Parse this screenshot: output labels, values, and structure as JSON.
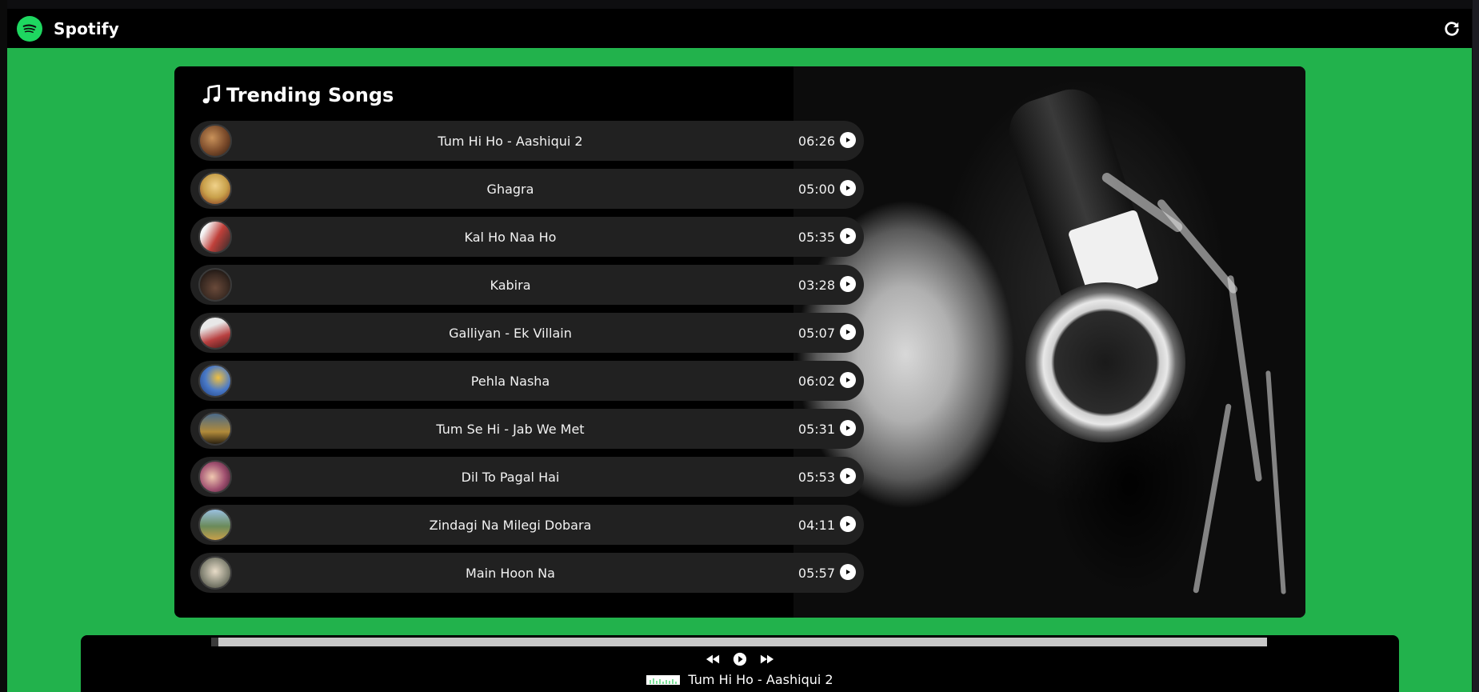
{
  "navbar": {
    "brand": "Spotify",
    "logo_icon": "spotify-logo-icon",
    "refresh_icon": "refresh-icon"
  },
  "colors": {
    "accent_green": "#22b24c",
    "logo_green": "#1ed760",
    "row_bg": "#212121",
    "card_bg": "#000000"
  },
  "main": {
    "title": "Trending Songs",
    "title_icon": "music-note-icon",
    "songs": [
      {
        "name": "Tum Hi Ho - Aashiqui 2",
        "duration": "06:26",
        "thumb_color": "#7a4a2a"
      },
      {
        "name": "Ghagra",
        "duration": "05:00",
        "thumb_color": "#c8a04a"
      },
      {
        "name": "Kal Ho Naa Ho",
        "duration": "05:35",
        "thumb_color": "#c0403a"
      },
      {
        "name": "Kabira",
        "duration": "03:28",
        "thumb_color": "#3a2a22"
      },
      {
        "name": "Galliyan - Ek Villain",
        "duration": "05:07",
        "thumb_color": "#b84040"
      },
      {
        "name": "Pehla Nasha",
        "duration": "06:02",
        "thumb_color": "#4a7ac8"
      },
      {
        "name": "Tum Se Hi - Jab We Met",
        "duration": "05:31",
        "thumb_color": "#b08a3a"
      },
      {
        "name": "Dil To Pagal Hai",
        "duration": "05:53",
        "thumb_color": "#a05070"
      },
      {
        "name": "Zindagi Na Milegi Dobara",
        "duration": "04:11",
        "thumb_color": "#6a8a5a"
      },
      {
        "name": "Main Hoon Na",
        "duration": "05:57",
        "thumb_color": "#8a8a7a"
      }
    ]
  },
  "player": {
    "progress": 0.007,
    "now_playing": "Tum Hi Ho - Aashiqui 2",
    "controls": [
      "previous-icon",
      "play-icon",
      "next-icon"
    ]
  }
}
